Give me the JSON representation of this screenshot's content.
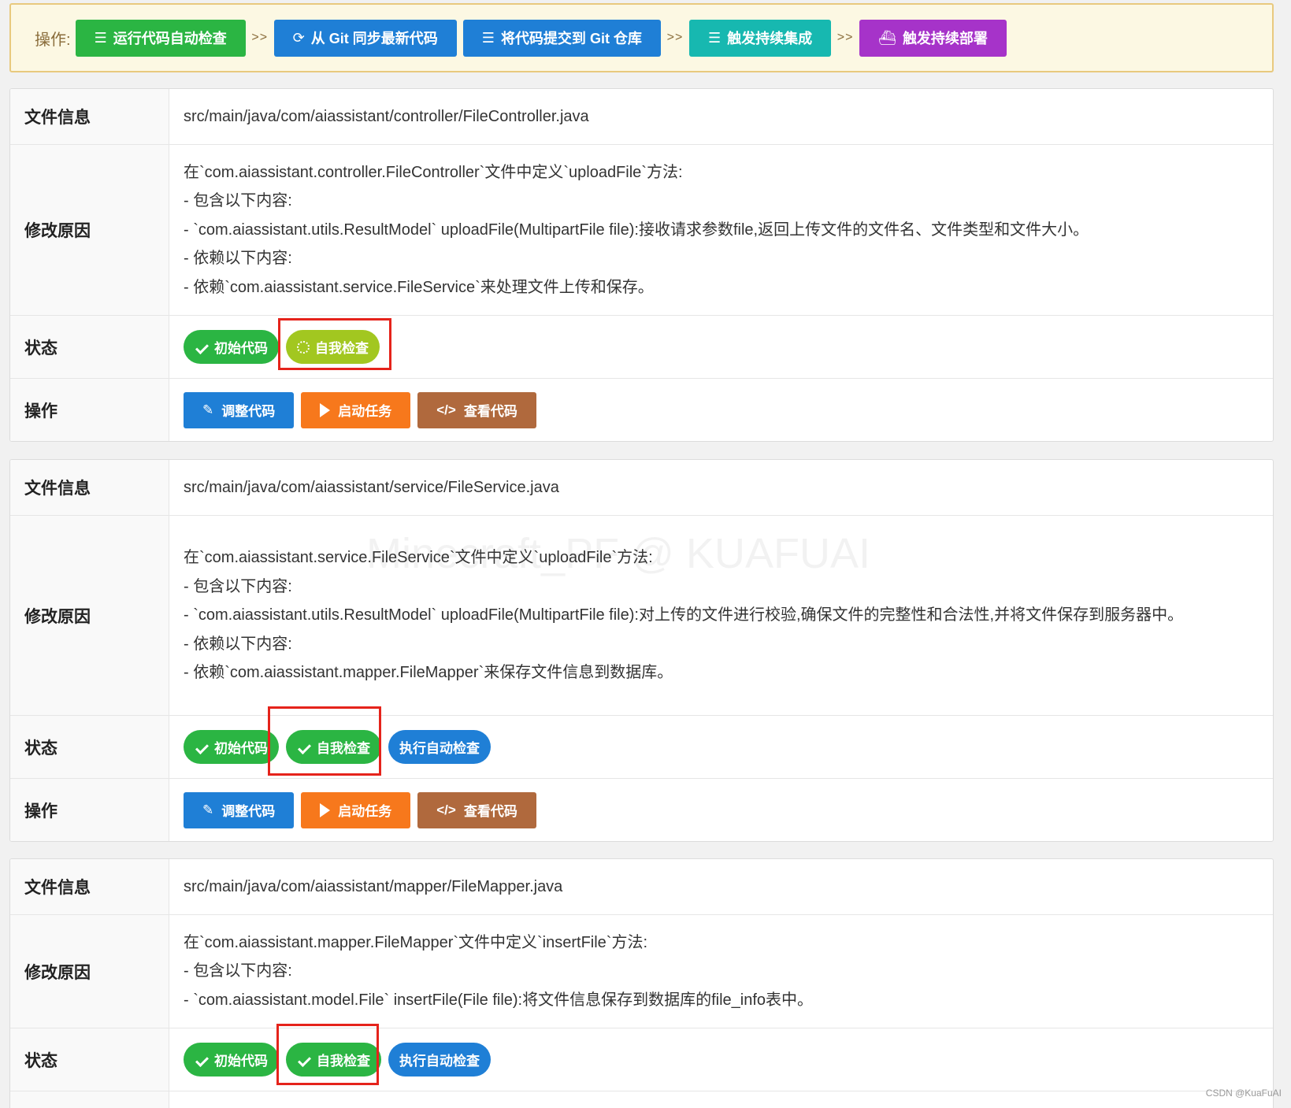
{
  "toolbar": {
    "label": "操作:",
    "separator": ">>",
    "buttons": [
      {
        "label": "运行代码自动检查",
        "icon": "list-check-icon",
        "color": "#2bb543"
      },
      {
        "label": "从 Git 同步最新代码",
        "icon": "sync-icon",
        "color": "#1f7fd6"
      },
      {
        "label": "将代码提交到 Git 仓库",
        "icon": "list-check-icon",
        "color": "#1f7fd6"
      },
      {
        "label": "触发持续集成",
        "icon": "list-check-icon",
        "color": "#17b8b0"
      },
      {
        "label": "触发持续部署",
        "icon": "docker-icon",
        "color": "#a633c9"
      }
    ]
  },
  "labels": {
    "file_info": "文件信息",
    "reason": "修改原因",
    "status": "状态",
    "operations": "操作"
  },
  "status_labels": {
    "initial_code": "初始代码",
    "self_check": "自我检查",
    "run_auto_check": "执行自动检查"
  },
  "action_labels": {
    "adjust": "调整代码",
    "start": "启动任务",
    "view": "查看代码"
  },
  "files": [
    {
      "path": "src/main/java/com/aiassistant/controller/FileController.java",
      "reason_lines": [
        "在`com.aiassistant.controller.FileController`文件中定义`uploadFile`方法:",
        "- 包含以下内容:",
        "- `com.aiassistant.utils.ResultModel` uploadFile(MultipartFile file):接收请求参数file,返回上传文件的文件名、文件类型和文件大小。",
        "- 依赖以下内容:",
        "- 依赖`com.aiassistant.service.FileService`来处理文件上传和保存。"
      ],
      "self_check_state": "running"
    },
    {
      "path": "src/main/java/com/aiassistant/service/FileService.java",
      "reason_lines": [
        "在`com.aiassistant.service.FileService`文件中定义`uploadFile`方法:",
        "- 包含以下内容:",
        "- `com.aiassistant.utils.ResultModel` uploadFile(MultipartFile file):对上传的文件进行校验,确保文件的完整性和合法性,并将文件保存到服务器中。",
        "- 依赖以下内容:",
        "- 依赖`com.aiassistant.mapper.FileMapper`来保存文件信息到数据库。"
      ],
      "self_check_state": "done"
    },
    {
      "path": "src/main/java/com/aiassistant/mapper/FileMapper.java",
      "reason_lines": [
        "在`com.aiassistant.mapper.FileMapper`文件中定义`insertFile`方法:",
        "- 包含以下内容:",
        "- `com.aiassistant.model.File` insertFile(File file):将文件信息保存到数据库的file_info表中。"
      ],
      "self_check_state": "done"
    }
  ],
  "watermark": "Minecraft_PF @ KUAFUAI",
  "credit": "CSDN @KuaFuAI"
}
